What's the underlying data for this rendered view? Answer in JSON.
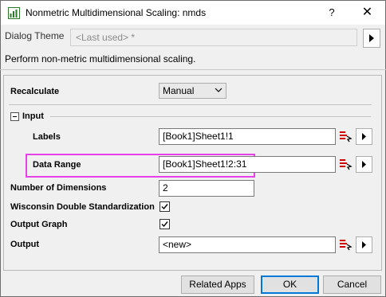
{
  "window": {
    "title": "Nonmetric Multidimensional Scaling: nmds",
    "help_label": "?",
    "close_label": "✕"
  },
  "theme": {
    "label": "Dialog Theme",
    "value": "<Last used> *"
  },
  "description": "Perform non-metric multidimensional scaling.",
  "form": {
    "recalculate": {
      "label": "Recalculate",
      "value": "Manual"
    },
    "input_group": {
      "label": "Input",
      "expanded": true
    },
    "labels": {
      "label": "Labels",
      "value": "[Book1]Sheet1!1"
    },
    "data_range": {
      "label": "Data Range",
      "value": "[Book1]Sheet1!2:31"
    },
    "num_dimensions": {
      "label": "Number of Dimensions",
      "value": "2"
    },
    "wisconsin": {
      "label": "Wisconsin Double Standardization",
      "checked": true
    },
    "output_graph": {
      "label": "Output Graph",
      "checked": true
    },
    "output": {
      "label": "Output",
      "value": "<new>"
    }
  },
  "buttons": {
    "related_apps": "Related Apps",
    "ok": "OK",
    "cancel": "Cancel"
  },
  "colors": {
    "highlight": "#e840e8",
    "ok_border": "#0078d7"
  },
  "icons": {
    "app": "origin-app-icon",
    "range_select": "range-select-icon",
    "flyout": "triangle-right-icon",
    "check": "checkmark-icon",
    "collapse": "minus-box-icon"
  }
}
